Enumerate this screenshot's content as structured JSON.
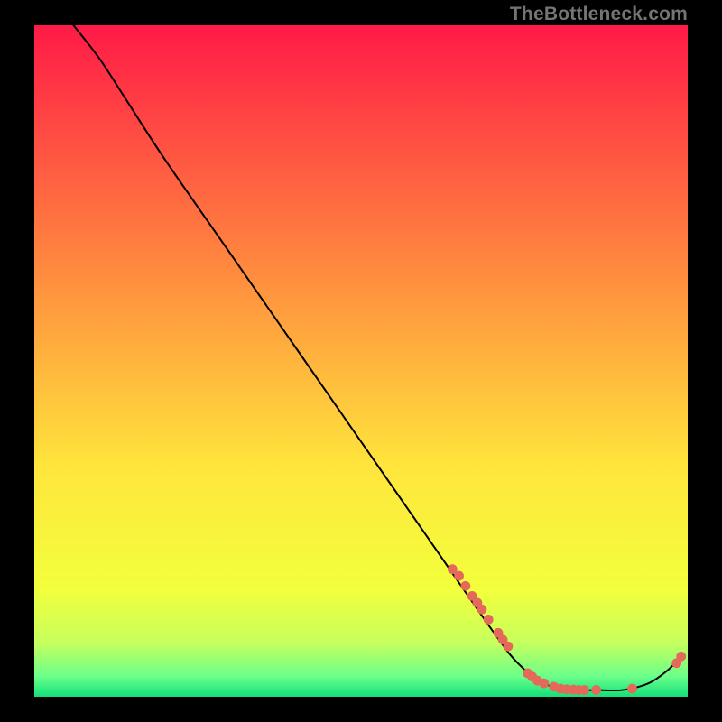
{
  "watermark": {
    "text": "TheBottleneck.com"
  },
  "colors": {
    "line": "#000000",
    "marker": "#e4695a",
    "gradient_top": "#ff1a47",
    "gradient_upper_mid": "#ff8f3e",
    "gradient_mid": "#ffe63c",
    "gradient_lower1": "#f2ff3c",
    "gradient_lower2": "#c6ff5d",
    "gradient_lower3": "#6aff8a",
    "gradient_bottom": "#13e07a"
  },
  "chart_data": {
    "type": "line",
    "title": "",
    "xlabel": "",
    "ylabel": "",
    "xlim": [
      0,
      100
    ],
    "ylim": [
      0,
      100
    ],
    "grid": false,
    "series": [
      {
        "name": "curve",
        "note": "y values are interpreted as 0=bottom (best / green), 100=top (worst / red)",
        "points": [
          {
            "x": 6,
            "y": 100
          },
          {
            "x": 10,
            "y": 95
          },
          {
            "x": 14,
            "y": 89
          },
          {
            "x": 20,
            "y": 80
          },
          {
            "x": 30,
            "y": 66
          },
          {
            "x": 40,
            "y": 52
          },
          {
            "x": 50,
            "y": 38
          },
          {
            "x": 60,
            "y": 24
          },
          {
            "x": 70,
            "y": 10
          },
          {
            "x": 74,
            "y": 5
          },
          {
            "x": 78,
            "y": 2
          },
          {
            "x": 82,
            "y": 1
          },
          {
            "x": 86,
            "y": 1
          },
          {
            "x": 90,
            "y": 1
          },
          {
            "x": 94,
            "y": 2
          },
          {
            "x": 97,
            "y": 4
          },
          {
            "x": 99,
            "y": 6
          }
        ]
      }
    ],
    "markers": {
      "name": "highlighted-points",
      "points": [
        {
          "x": 64,
          "y": 19
        },
        {
          "x": 65,
          "y": 18
        },
        {
          "x": 66,
          "y": 16.5
        },
        {
          "x": 67,
          "y": 15
        },
        {
          "x": 67.8,
          "y": 14
        },
        {
          "x": 68.5,
          "y": 13
        },
        {
          "x": 69.5,
          "y": 11.5
        },
        {
          "x": 71,
          "y": 9.5
        },
        {
          "x": 71.7,
          "y": 8.5
        },
        {
          "x": 72.5,
          "y": 7.5
        },
        {
          "x": 75.5,
          "y": 3.5
        },
        {
          "x": 76.2,
          "y": 3
        },
        {
          "x": 77,
          "y": 2.4
        },
        {
          "x": 78,
          "y": 2
        },
        {
          "x": 79.5,
          "y": 1.5
        },
        {
          "x": 80.5,
          "y": 1.2
        },
        {
          "x": 81.5,
          "y": 1.1
        },
        {
          "x": 82.5,
          "y": 1.05
        },
        {
          "x": 83.3,
          "y": 1
        },
        {
          "x": 84.2,
          "y": 1
        },
        {
          "x": 86,
          "y": 1
        },
        {
          "x": 91.5,
          "y": 1.2
        },
        {
          "x": 98.3,
          "y": 5
        },
        {
          "x": 99,
          "y": 6
        }
      ]
    }
  }
}
